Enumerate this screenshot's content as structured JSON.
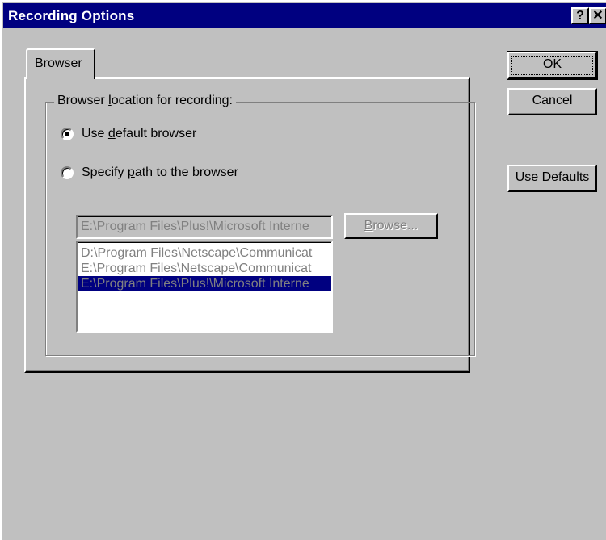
{
  "window": {
    "title": "Recording Options",
    "help_glyph": "?",
    "close_glyph": "✕"
  },
  "tabs": [
    {
      "label": "Browser",
      "active": true
    }
  ],
  "group": {
    "label": "Browser location for recording:"
  },
  "radios": [
    {
      "label": "Use default browser",
      "checked": true
    },
    {
      "label": "Specify path to the browser",
      "checked": false
    }
  ],
  "path_input": {
    "value": "E:\\Program Files\\Plus!\\Microsoft Interne",
    "disabled": true
  },
  "browse_button": {
    "label": "Browse...",
    "disabled": true
  },
  "browser_list": [
    {
      "label": "D:\\Program Files\\Netscape\\Communicat",
      "selected": false
    },
    {
      "label": "E:\\Program Files\\Netscape\\Communicat",
      "selected": false
    },
    {
      "label": "E:\\Program Files\\Plus!\\Microsoft Interne",
      "selected": true
    }
  ],
  "buttons": {
    "ok": "OK",
    "cancel": "Cancel",
    "use_defaults": "Use Defaults"
  },
  "colors": {
    "title_bar": "#000080",
    "face": "#c0c0c0",
    "selection": "#000080",
    "disabled_text": "#808080"
  }
}
